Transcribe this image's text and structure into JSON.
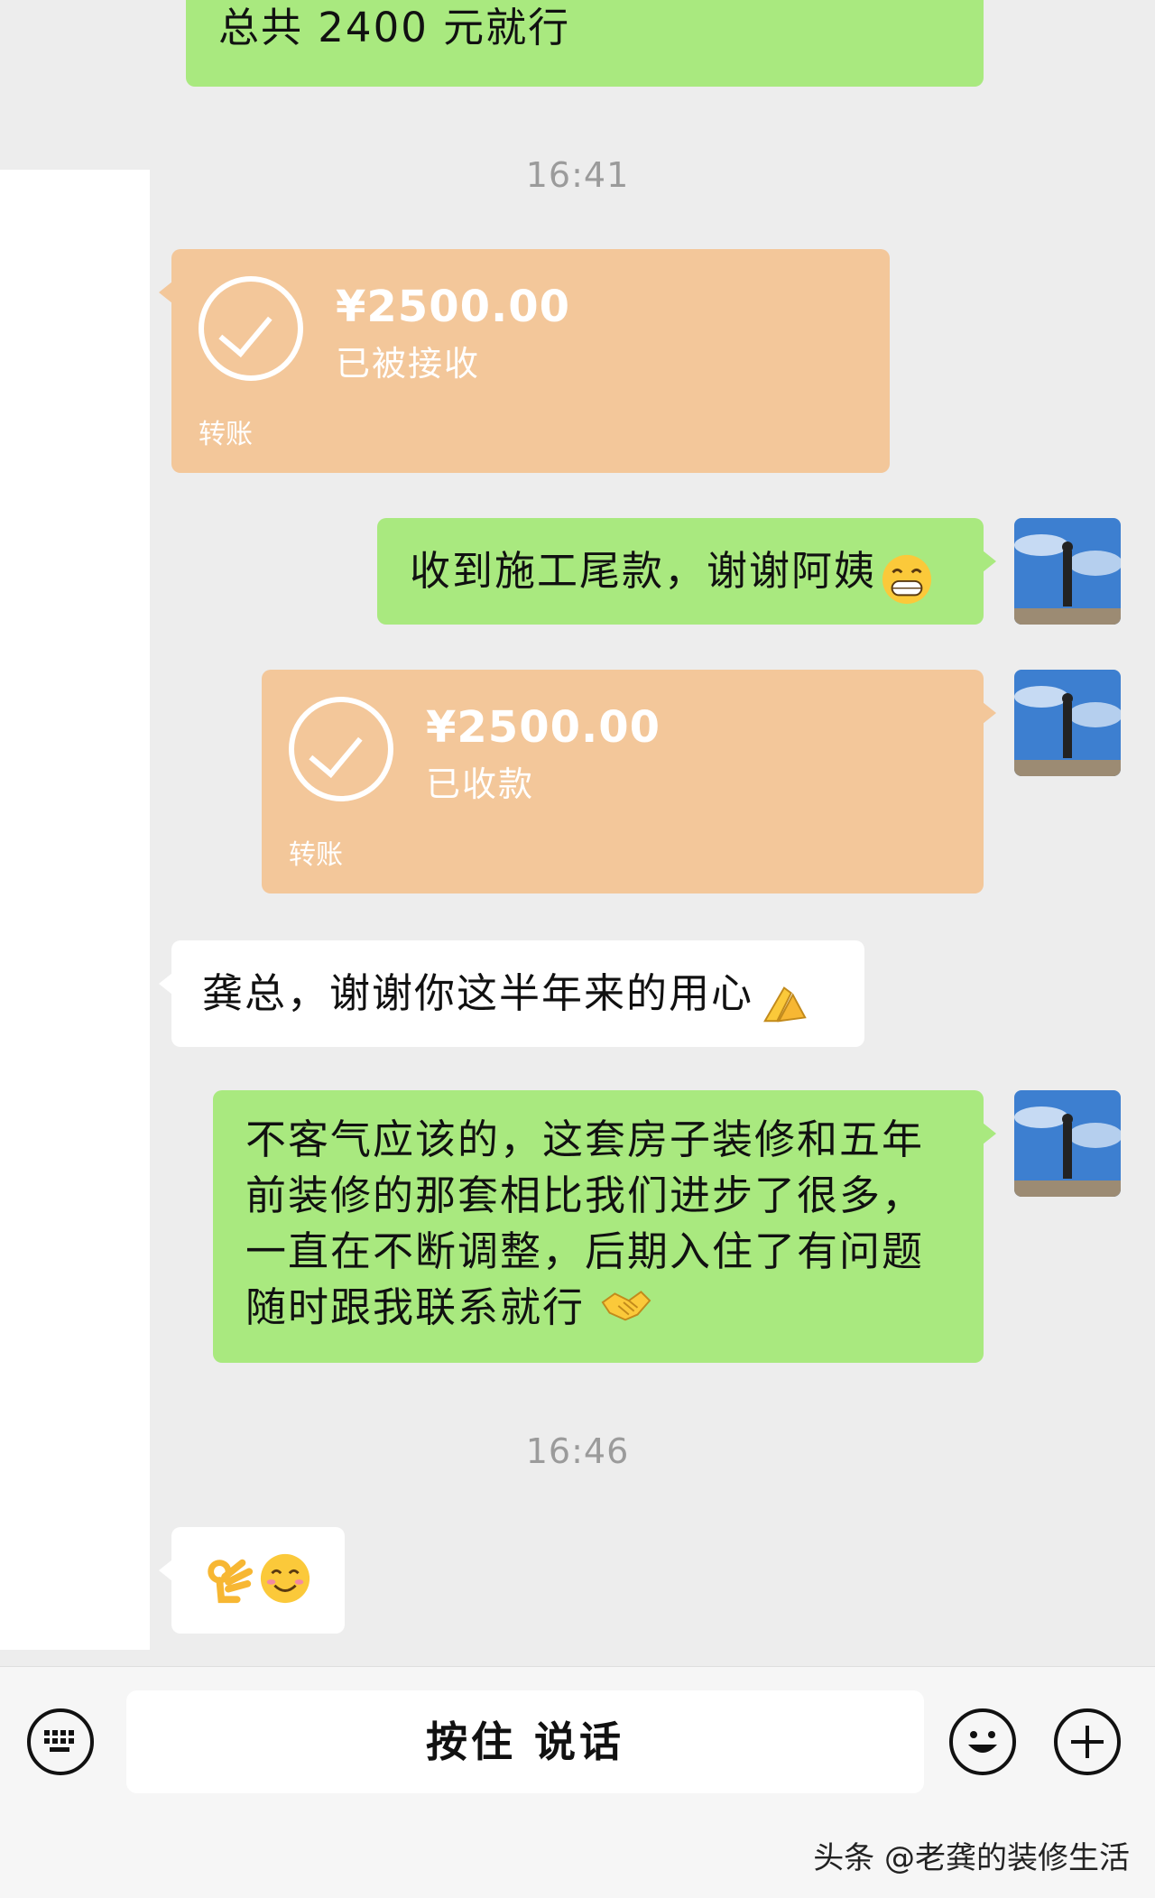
{
  "messages": {
    "top_partial": "总共 2400 元就行",
    "time1": "16:41",
    "transfer_received": {
      "amount": "¥2500.00",
      "status": "已被接收",
      "label": "转账"
    },
    "reply1": "收到施工尾款，谢谢阿姨",
    "transfer_collected": {
      "amount": "¥2500.00",
      "status": "已收款",
      "label": "转账"
    },
    "aunt_msg": "龚总，谢谢你这半年来的用心",
    "reply2": "不客气应该的，这套房子装修和五年前装修的那套相比我们进步了很多，一直在不断调整，后期入住了有问题随时跟我联系就行",
    "time2": "16:46"
  },
  "icons": {
    "reply1_emoji": "grin-emoji",
    "aunt_emoji": "pray-hands-emoji",
    "reply2_emoji": "handshake-emoji",
    "last_emojis": [
      "ok-hand-emoji",
      "smile-emoji"
    ]
  },
  "input_bar": {
    "talk_label": "按住 说话"
  },
  "watermark": "头条 @老龚的装修生活",
  "colors": {
    "sent_bubble": "#a9e97f",
    "received_bubble": "#ffffff",
    "transfer_bubble": "#f3c79a",
    "background": "#ededed"
  }
}
